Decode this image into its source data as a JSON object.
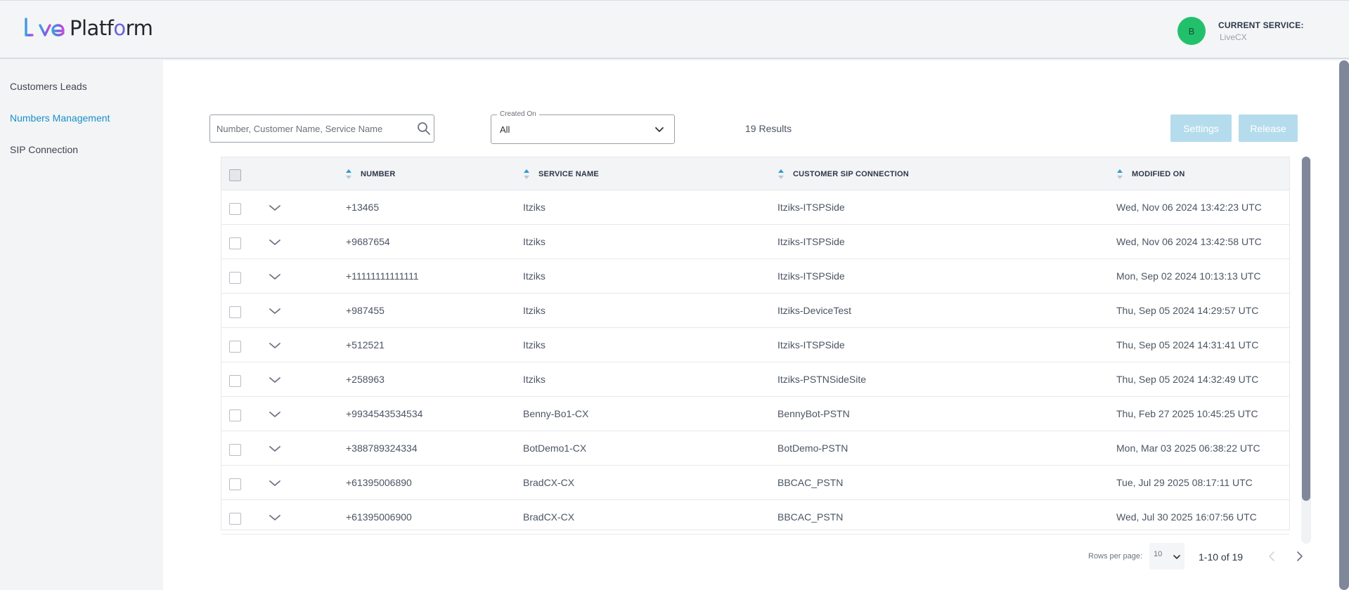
{
  "app": {
    "logo_text": "LivePlatform",
    "avatar_initial": "B",
    "current_service_label": "CURRENT SERVICE:",
    "current_service_value": "LiveCX",
    "avatar_color": "#23c06c"
  },
  "sidebar": {
    "items": [
      {
        "label": "Customers Leads",
        "active": false
      },
      {
        "label": "Numbers Management",
        "active": true
      },
      {
        "label": "SIP Connection",
        "active": false
      }
    ]
  },
  "toolbar": {
    "search_placeholder": "Number, Customer Name, Service Name",
    "search_value": "",
    "created_on_label": "Created On",
    "created_on_value": "All",
    "results_text": "19 Results",
    "settings_label": "Settings",
    "release_label": "Release",
    "button_color": "#b5dcec"
  },
  "table": {
    "columns": [
      "NUMBER",
      "SERVICE NAME",
      "CUSTOMER SIP CONNECTION",
      "MODIFIED ON"
    ],
    "rows": [
      {
        "number": "+13465",
        "service": "Itziks",
        "sip": "Itziks-ITSPSide",
        "modified": "Wed, Nov 06 2024 13:42:23 UTC"
      },
      {
        "number": "+9687654",
        "service": "Itziks",
        "sip": "Itziks-ITSPSide",
        "modified": "Wed, Nov 06 2024 13:42:58 UTC"
      },
      {
        "number": "+11111111111111",
        "service": "Itziks",
        "sip": "Itziks-ITSPSide",
        "modified": "Mon, Sep 02 2024 10:13:13 UTC"
      },
      {
        "number": "+987455",
        "service": "Itziks",
        "sip": "Itziks-DeviceTest",
        "modified": "Thu, Sep 05 2024 14:29:57 UTC"
      },
      {
        "number": "+512521",
        "service": "Itziks",
        "sip": "Itziks-ITSPSide",
        "modified": "Thu, Sep 05 2024 14:31:41 UTC"
      },
      {
        "number": "+258963",
        "service": "Itziks",
        "sip": "Itziks-PSTNSideSite",
        "modified": "Thu, Sep 05 2024 14:32:49 UTC"
      },
      {
        "number": "+9934543534534",
        "service": "Benny-Bo1-CX",
        "sip": "BennyBot-PSTN",
        "modified": "Thu, Feb 27 2025 10:45:25 UTC"
      },
      {
        "number": "+388789324334",
        "service": "BotDemo1-CX",
        "sip": "BotDemo-PSTN",
        "modified": "Mon, Mar 03 2025 06:38:22 UTC"
      },
      {
        "number": "+61395006890",
        "service": "BradCX-CX",
        "sip": "BBCAC_PSTN",
        "modified": "Tue, Jul 29 2025 08:17:11 UTC"
      },
      {
        "number": "+61395006900",
        "service": "BradCX-CX",
        "sip": "BBCAC_PSTN",
        "modified": "Wed, Jul 30 2025 16:07:56 UTC"
      }
    ]
  },
  "pagination": {
    "rows_per_page_label": "Rows per page:",
    "rows_per_page_value": "10",
    "range_text": "1-10 of 19"
  }
}
